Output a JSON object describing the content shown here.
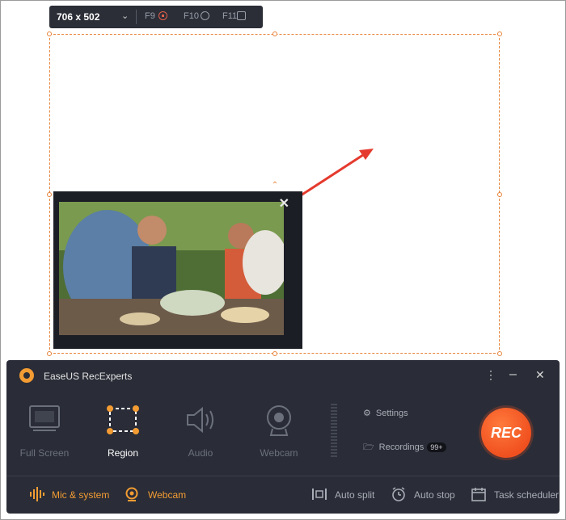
{
  "size_bar": {
    "dimensions": "706 x 502",
    "hotkeys": [
      {
        "key": "F9",
        "icon": "stop-record-icon"
      },
      {
        "key": "F10",
        "icon": "pause-icon"
      },
      {
        "key": "F11",
        "icon": "screenshot-icon"
      }
    ]
  },
  "app": {
    "title": "EaseUS RecExperts",
    "modes": [
      {
        "label": "Full Screen",
        "icon": "monitor-icon",
        "active": false
      },
      {
        "label": "Region",
        "icon": "region-select-icon",
        "active": true
      },
      {
        "label": "Audio",
        "icon": "speaker-icon",
        "active": false
      },
      {
        "label": "Webcam",
        "icon": "webcam-icon",
        "active": false
      }
    ],
    "settings_label": "Settings",
    "recordings_label": "Recordings",
    "recordings_badge": "99+",
    "rec_label": "REC",
    "footer": {
      "mic_label": "Mic & system",
      "webcam_label": "Webcam",
      "auto_split": "Auto split",
      "auto_stop": "Auto stop",
      "task_scheduler": "Task scheduler"
    }
  },
  "colors": {
    "accent": "#f39c33",
    "rec": "#f0501f",
    "panel": "#2a2d37",
    "region_border": "#e8833a",
    "arrow": "#e53a2e"
  }
}
